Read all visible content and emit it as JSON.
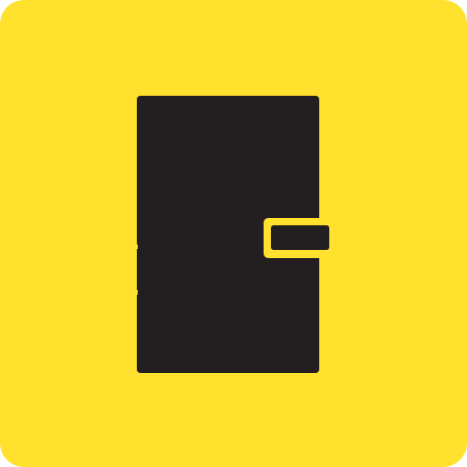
{
  "icon": {
    "semantic_name": "notebook-icon",
    "colors": {
      "background": "#FFE12E",
      "foreground": "#231F20",
      "clasp_outline": "#FFE12E"
    }
  }
}
